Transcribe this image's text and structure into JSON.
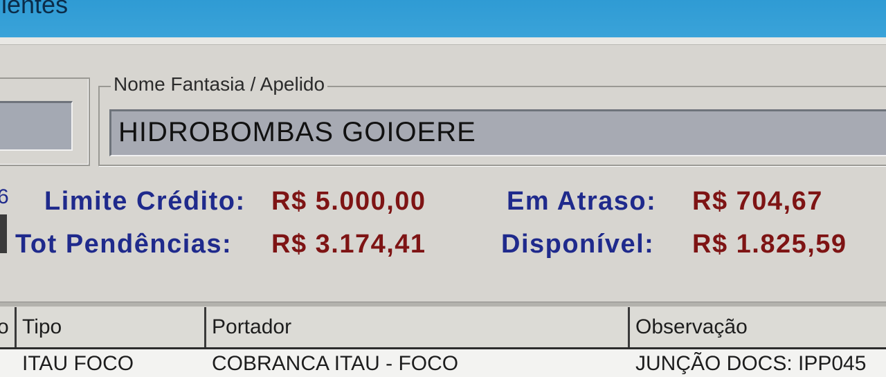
{
  "window": {
    "title": "lientes"
  },
  "cliente": {
    "nome_fantasia_label": "Nome Fantasia / Apelido",
    "nome_fantasia_value": "HIDROBOMBAS GOIOERE"
  },
  "resumo": {
    "limite_credito_label": "Limite Crédito:",
    "limite_credito_value": "R$ 5.000,00",
    "em_atraso_label": "Em Atraso:",
    "em_atraso_value": "R$ 704,67",
    "tot_pendencias_label": "Tot Pendências:",
    "tot_pendencias_value": "R$ 3.174,41",
    "disponivel_label": "Disponível:",
    "disponivel_value": "R$ 1.825,59",
    "edge_glyph": "6"
  },
  "grid": {
    "columns": [
      "o",
      "Tipo",
      "Portador",
      "Observação"
    ],
    "rows": [
      [
        "",
        "ITAU FOCO",
        "COBRANCA ITAU - FOCO",
        "JUNÇÃO DOCS: IPP045"
      ]
    ]
  },
  "colors": {
    "label_blue": "#1f2a8c",
    "value_red": "#7e1414",
    "titlebar_blue": "#3aa3d9"
  }
}
